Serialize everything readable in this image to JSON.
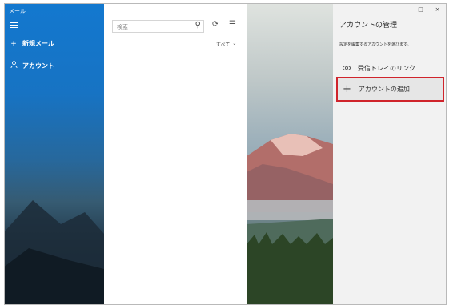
{
  "app": {
    "title": "メール"
  },
  "sidebar": {
    "menu_icon": "hamburger-icon",
    "items": [
      {
        "label": "新規メール",
        "icon": "plus-icon"
      },
      {
        "label": "アカウント",
        "icon": "person-icon"
      }
    ]
  },
  "list_pane": {
    "search_placeholder": "検索",
    "filter_label": "すべて"
  },
  "account_panel": {
    "title": "アカウントの管理",
    "subtitle": "設定を編集するアカウントを選びます。",
    "link_label": "受信トレイのリンク",
    "add_label": "アカウントの追加"
  },
  "window_controls": [
    "–",
    "□",
    "×"
  ],
  "colors": {
    "accent": "#1378cf",
    "highlight_border": "#d0242c"
  }
}
